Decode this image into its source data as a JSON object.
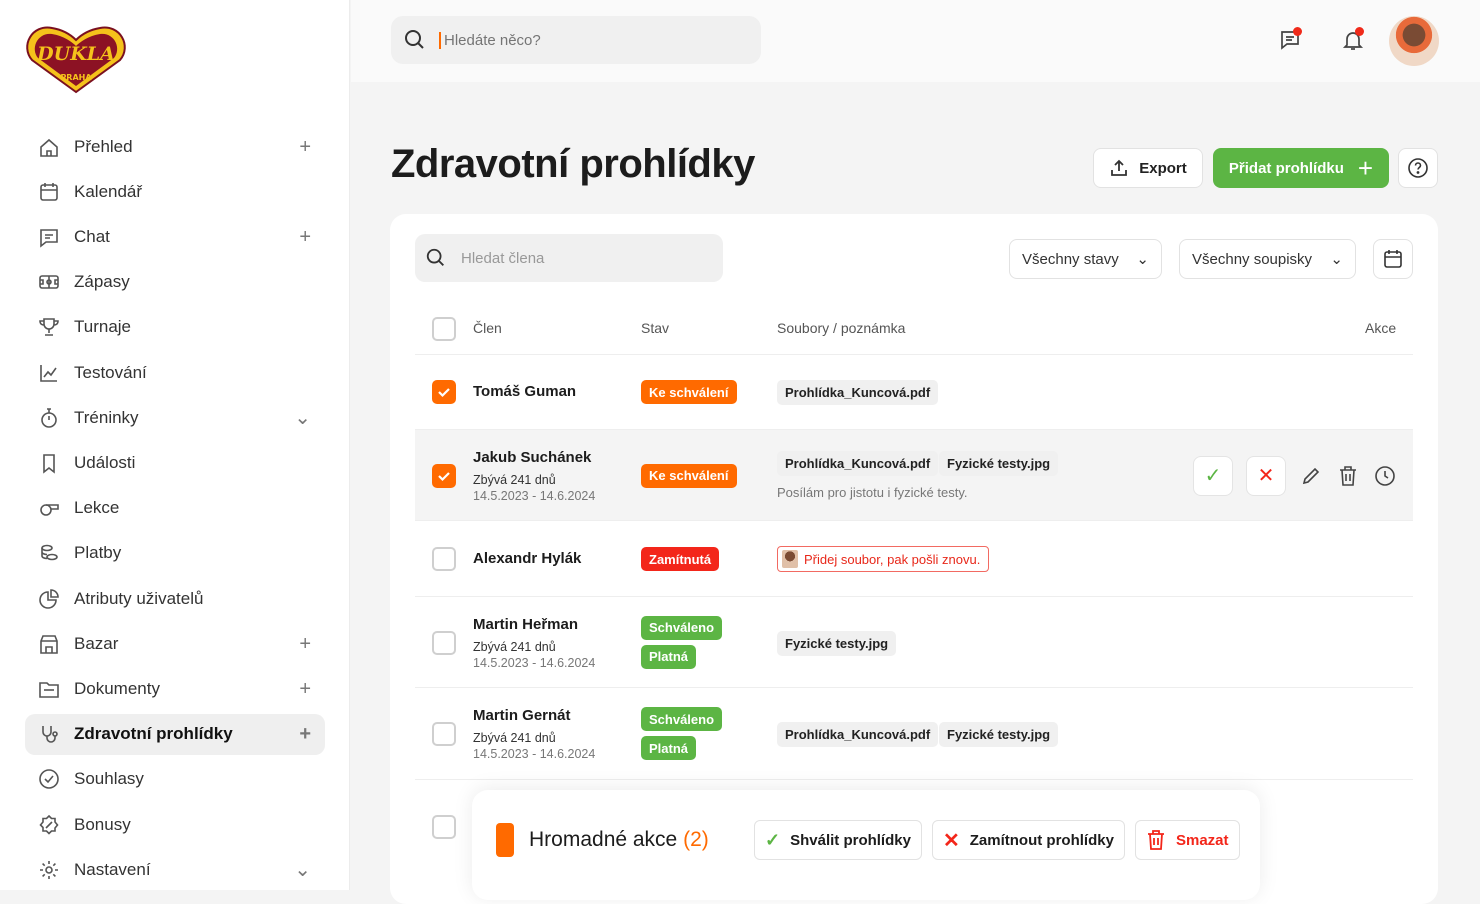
{
  "logo": {
    "text": "DUKLA",
    "subtext": "PRAHA"
  },
  "sidebar": {
    "items": [
      {
        "label": "Přehled",
        "icon": "home-icon",
        "tail": "+"
      },
      {
        "label": "Kalendář",
        "icon": "calendar-icon",
        "tail": ""
      },
      {
        "label": "Chat",
        "icon": "chat-icon",
        "tail": "+"
      },
      {
        "label": "Zápasy",
        "icon": "field-icon",
        "tail": ""
      },
      {
        "label": "Turnaje",
        "icon": "trophy-icon",
        "tail": ""
      },
      {
        "label": "Testování",
        "icon": "chart-line-icon",
        "tail": ""
      },
      {
        "label": "Tréninky",
        "icon": "stopwatch-icon",
        "tail": "⌄"
      },
      {
        "label": "Události",
        "icon": "bookmark-icon",
        "tail": ""
      },
      {
        "label": "Lekce",
        "icon": "whistle-icon",
        "tail": ""
      },
      {
        "label": "Platby",
        "icon": "coins-icon",
        "tail": ""
      },
      {
        "label": "Atributy uživatelů",
        "icon": "pie-chart-icon",
        "tail": ""
      },
      {
        "label": "Bazar",
        "icon": "store-icon",
        "tail": "+"
      },
      {
        "label": "Dokumenty",
        "icon": "folder-icon",
        "tail": "+"
      },
      {
        "label": "Zdravotní prohlídky",
        "icon": "stethoscope-icon",
        "tail": "+",
        "active": true
      },
      {
        "label": "Souhlasy",
        "icon": "check-circle-icon",
        "tail": ""
      },
      {
        "label": "Bonusy",
        "icon": "badge-icon",
        "tail": ""
      },
      {
        "label": "Nastavení",
        "icon": "gear-icon",
        "tail": "⌄"
      }
    ]
  },
  "topbar": {
    "search_placeholder": "Hledáte něco?",
    "notification_dot_color": "#f02a1a"
  },
  "page": {
    "title": "Zdravotní prohlídky",
    "export_label": "Export",
    "add_label": "Přidat prohlídku",
    "accent": "#ff6a00",
    "green": "#5cb544"
  },
  "filters": {
    "search_placeholder": "Hledat člena",
    "status": "Všechny stavy",
    "roster": "Všechny soupisky"
  },
  "table": {
    "headers": {
      "member": "Člen",
      "status": "Stav",
      "files": "Soubory / poznámka",
      "actions": "Akce"
    },
    "rows": [
      {
        "name": "Tomáš Guman",
        "checked": true,
        "badges": [
          "Ke schválení"
        ],
        "files": [
          "Prohlídka_Kuncová.pdf"
        ]
      },
      {
        "name": "Jakub Suchánek",
        "checked": true,
        "remaining": "Zbývá 241 dnů",
        "period": "14.5.2023 - 14.6.2024",
        "badges": [
          "Ke schválení"
        ],
        "files": [
          "Prohlídka_Kuncová.pdf",
          "Fyzické testy.jpg"
        ],
        "note": "Posílám pro jistotu i fyzické testy."
      },
      {
        "name": "Alexandr Hylák",
        "checked": false,
        "badges": [
          "Zamítnutá"
        ],
        "reject_note": "Přidej soubor, pak pošli znovu."
      },
      {
        "name": "Martin Heřman",
        "checked": false,
        "remaining": "Zbývá 241 dnů",
        "period": "14.5.2023 - 14.6.2024",
        "badges": [
          "Schváleno",
          "Platná"
        ],
        "files": [
          "Fyzické testy.jpg"
        ]
      },
      {
        "name": "Martin Gernát",
        "checked": false,
        "remaining": "Zbývá 241 dnů",
        "period": "14.5.2023 - 14.6.2024",
        "badges": [
          "Schváleno",
          "Platná"
        ],
        "files": [
          "Prohlídka_Kuncová.pdf",
          "Fyzické testy.jpg"
        ]
      }
    ]
  },
  "bulk": {
    "title": "Hromadné akce",
    "count": "(2)",
    "approve": "Shválit prohlídky",
    "reject": "Zamítnout prohlídky",
    "delete": "Smazat"
  }
}
